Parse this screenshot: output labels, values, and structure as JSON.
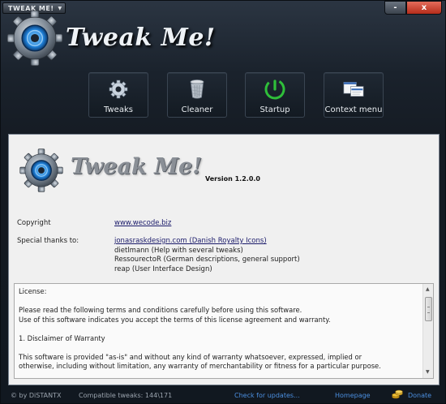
{
  "window": {
    "menu_title": "TWEAK ME!",
    "minimize_label": "-",
    "close_label": "x"
  },
  "header": {
    "logo_text": "Tweak Me!"
  },
  "nav": {
    "items": [
      {
        "label": "Tweaks",
        "icon": "gear-icon"
      },
      {
        "label": "Cleaner",
        "icon": "trash-icon"
      },
      {
        "label": "Startup",
        "icon": "power-icon"
      },
      {
        "label": "Context menu",
        "icon": "context-menu-icon"
      }
    ]
  },
  "about": {
    "logo_text": "Tweak Me!",
    "version": "Version 1.2.0.0",
    "copyright_label": "Copyright",
    "copyright_link": "www.wecode.biz",
    "thanks_label": "Special thanks to:",
    "thanks": [
      "jonasraskdesign.com (Danish Royalty Icons)",
      "dietlmann (Help with several tweaks)",
      "RessourectoR (German descriptions, general support)",
      "reap (User Interface Design)"
    ]
  },
  "license": {
    "lines": [
      "License:",
      "Please read the following terms and conditions carefully before using this software.",
      "Use of this software indicates you accept the terms of this license agreement and warranty.",
      "1. Disclaimer of Warranty",
      "This software is provided \"as-is\" and without any kind of warranty whatsoever, expressed,  implied or",
      "otherwise, including without limitation, any warranty of merchantability or  fitness for a particular purpose."
    ]
  },
  "footer": {
    "copyright": "© by DiSTANTX",
    "compat_label": "Compatible tweaks: 144\\171",
    "check_updates": "Check for updates...",
    "homepage": "Homepage",
    "donate": "Donate"
  },
  "colors": {
    "link_blue": "#4b8fe0",
    "close_red": "#c8402c",
    "startup_green": "#2fbf3a"
  }
}
